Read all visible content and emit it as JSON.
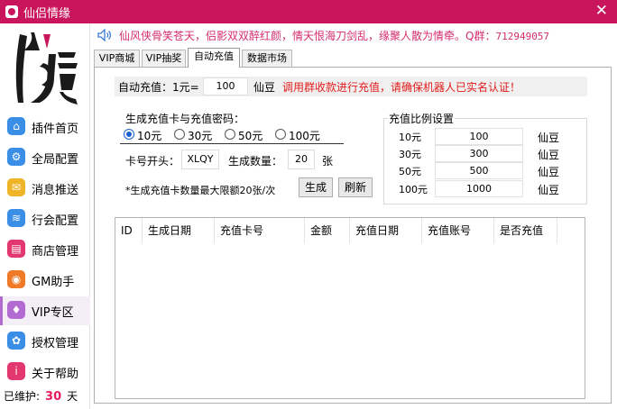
{
  "window": {
    "title": "仙侣情缘",
    "close_glyph": "✕"
  },
  "sidebar": {
    "items": [
      {
        "label": "插件首页",
        "icon": "home-icon",
        "color": "#3a8ee6"
      },
      {
        "label": "全局配置",
        "icon": "settings-icon",
        "color": "#3a8ee6"
      },
      {
        "label": "消息推送",
        "icon": "message-icon",
        "color": "#f0b428"
      },
      {
        "label": "行会配置",
        "icon": "layers-icon",
        "color": "#3a8ee6"
      },
      {
        "label": "商店管理",
        "icon": "shop-icon",
        "color": "#e2376f"
      },
      {
        "label": "GM助手",
        "icon": "gm-icon",
        "color": "#f07a28"
      },
      {
        "label": "VIP专区",
        "icon": "vip-icon",
        "color": "#b26bd1"
      },
      {
        "label": "授权管理",
        "icon": "license-icon",
        "color": "#3a8ee6"
      },
      {
        "label": "关于帮助",
        "icon": "help-icon",
        "color": "#e2376f"
      }
    ],
    "active_index": 6,
    "maintenance": {
      "prefix": "已维护:",
      "days": "30",
      "suffix": "天"
    }
  },
  "marquee": {
    "text": "仙风侠骨笑苍天，侣影双双醉红颜，情天恨海刀剑乱，缘聚人散为情牵。Q群：",
    "qq": "712949057"
  },
  "tabs": [
    {
      "label": "VIP商城"
    },
    {
      "label": "VIP抽奖"
    },
    {
      "label": "自动充值"
    },
    {
      "label": "数据市场"
    }
  ],
  "active_tab": 2,
  "recharge": {
    "label": "自动充值：1元=",
    "value": "100",
    "unit": "仙豆",
    "warning": "调用群收款进行充值，请确保机器人已实名认证！"
  },
  "generate": {
    "caption": "生成充值卡与充值密码：",
    "options": [
      "10元",
      "30元",
      "50元",
      "100元"
    ],
    "selected": 0,
    "prefix_label": "卡号开头：",
    "prefix_value": "XLQY",
    "count_label": "生成数量：",
    "count_value": "20",
    "count_unit": "张",
    "note": "*生成充值卡数量最大限额20张/次",
    "generate_btn": "生成",
    "refresh_btn": "刷新"
  },
  "ratio": {
    "caption": "充值比例设置",
    "rows": [
      {
        "amount": "10元",
        "value": "100",
        "unit": "仙豆"
      },
      {
        "amount": "30元",
        "value": "300",
        "unit": "仙豆"
      },
      {
        "amount": "50元",
        "value": "500",
        "unit": "仙豆"
      },
      {
        "amount": "100元",
        "value": "1000",
        "unit": "仙豆"
      }
    ]
  },
  "table": {
    "columns": [
      "ID",
      "生成日期",
      "充值卡号",
      "金额",
      "充值日期",
      "充值账号",
      "是否充值"
    ]
  },
  "colors": {
    "accent": "#c8155c",
    "warning": "#e21c1c",
    "marquee": "#d42d6e"
  }
}
